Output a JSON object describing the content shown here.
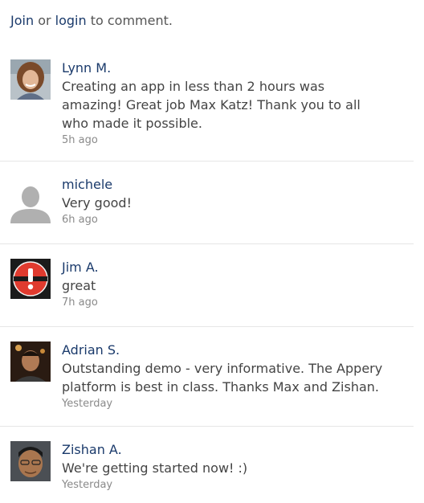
{
  "header": {
    "join_label": "Join",
    "or_text": "or",
    "login_label": "login",
    "suffix_text": "to comment."
  },
  "comments": [
    {
      "author": "Lynn M.",
      "text": "Creating an app in less than 2 hours was amazing! Great job Max Katz! Thank you to all who made it possible.",
      "time": "5h ago",
      "avatar_icon": "woman-portrait-avatar"
    },
    {
      "author": "michele",
      "text": "Very good!",
      "time": "6h ago",
      "avatar_icon": "default-silhouette-avatar"
    },
    {
      "author": "Jim A.",
      "text": "great",
      "time": "7h ago",
      "avatar_icon": "red-exclamation-badge-avatar"
    },
    {
      "author": "Adrian S.",
      "text": "Outstanding demo - very informative. The Appery platform is best in class. Thanks Max and Zishan.",
      "time": "Yesterday",
      "avatar_icon": "man-portrait-avatar"
    },
    {
      "author": "Zishan A.",
      "text": "We're getting started now! :)",
      "time": "Yesterday",
      "avatar_icon": "man-portrait-avatar"
    }
  ],
  "colors": {
    "link": "#1a3a6b",
    "text": "#444444",
    "muted": "#8a8a8a",
    "divider": "#e6e6e6"
  }
}
